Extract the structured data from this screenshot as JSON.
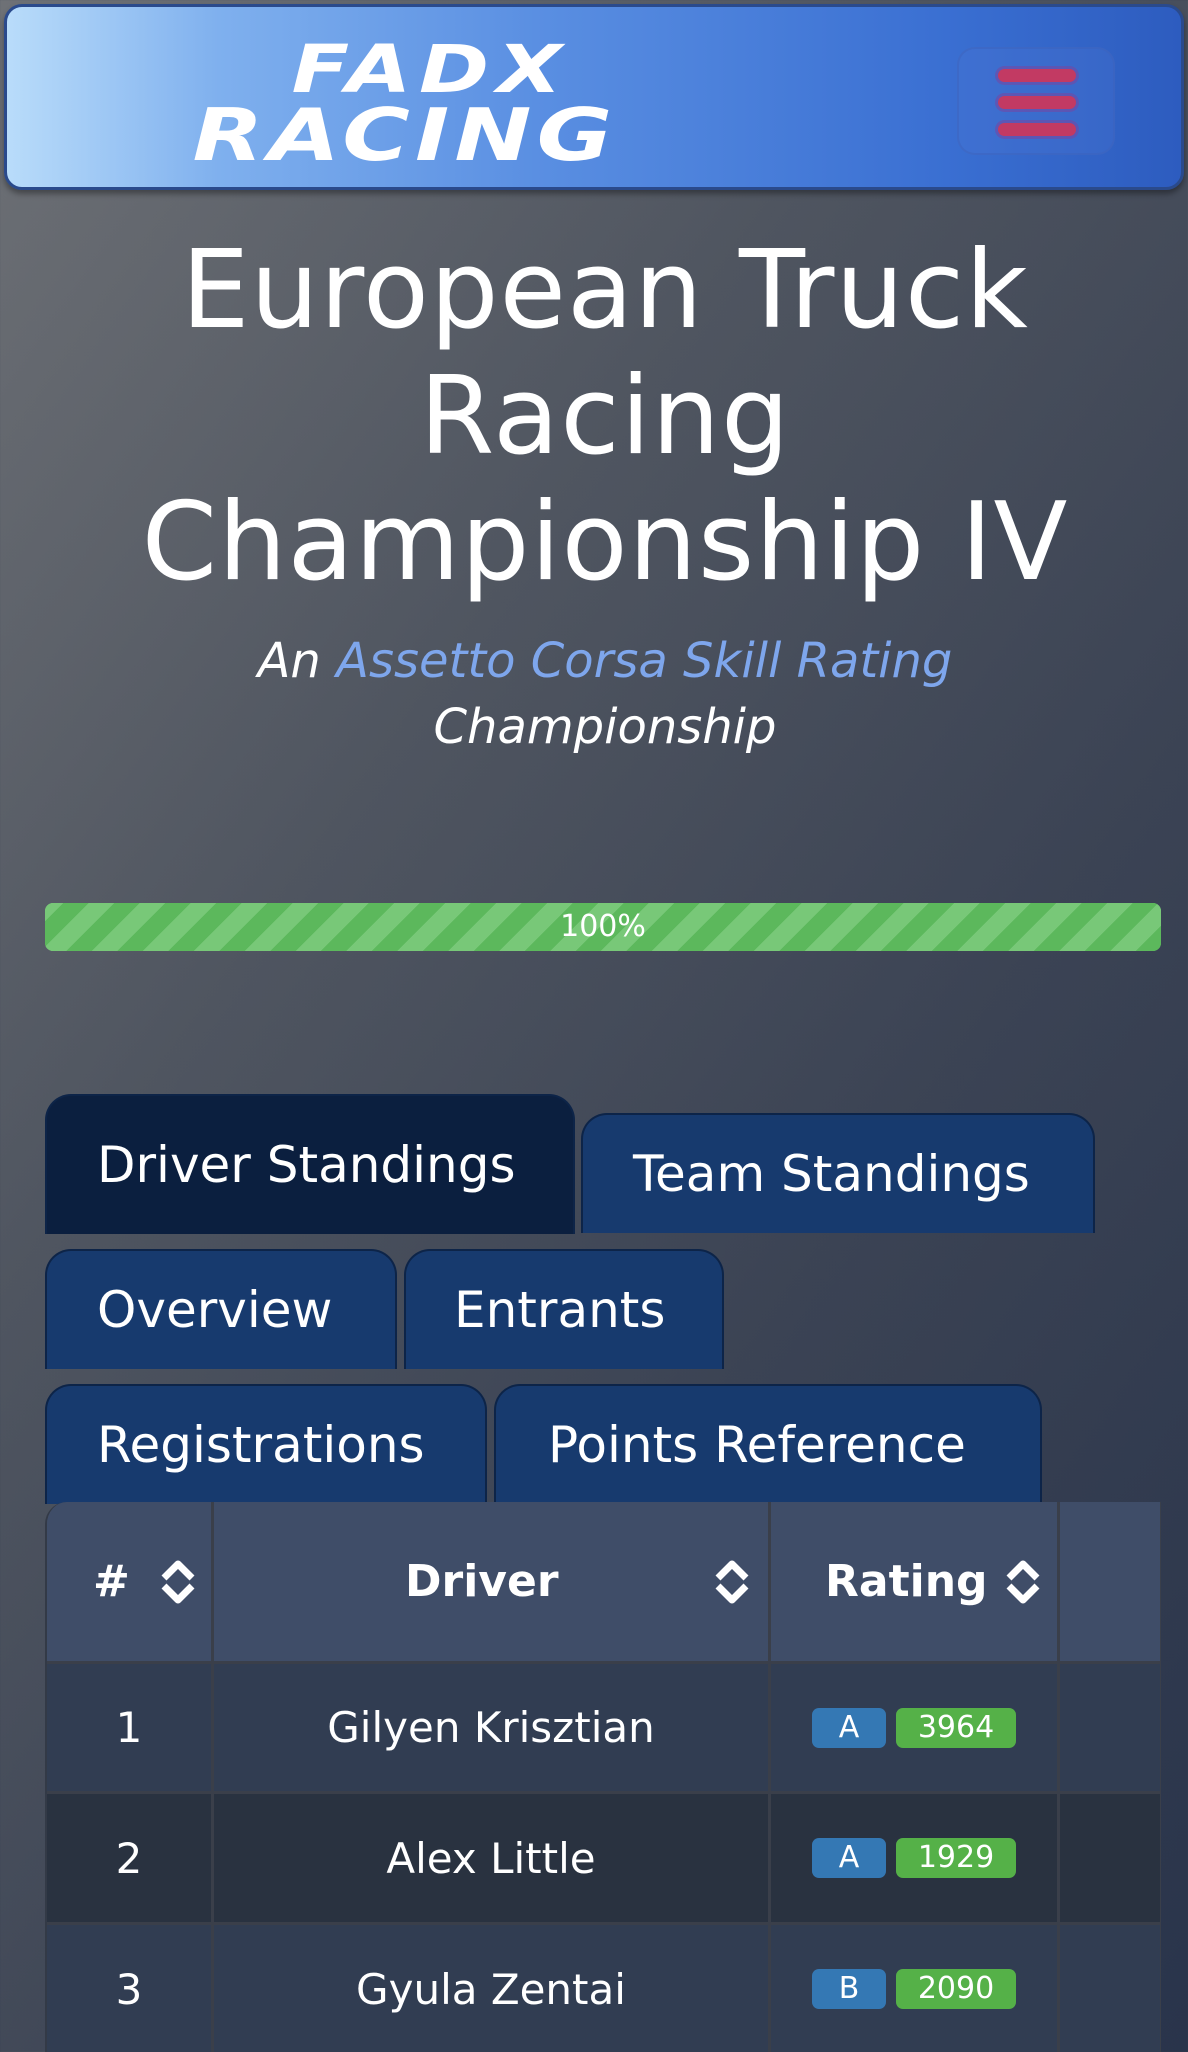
{
  "navbar": {
    "logo_line1": "FADX",
    "logo_line2": "RACING",
    "menu_icon": "hamburger-icon",
    "menu_color": "#c23a63"
  },
  "hero": {
    "title": "European Truck Racing Championship IV",
    "subtitle_prefix": "An",
    "subtitle_link": "Assetto Corsa Skill Rating",
    "subtitle_suffix": "Championship",
    "accent_color": "#7ea6ec"
  },
  "progress": {
    "value": 1.0,
    "label": "100%",
    "color": "#5cb85c"
  },
  "tabs": [
    {
      "label": "Driver Standings",
      "active": true
    },
    {
      "label": "Team Standings",
      "active": false
    },
    {
      "label": "Overview",
      "active": false
    },
    {
      "label": "Entrants",
      "active": false
    },
    {
      "label": "Registrations",
      "active": false
    },
    {
      "label": "Points Reference",
      "active": false
    }
  ],
  "table": {
    "headers": {
      "pos": "#",
      "driver": "Driver",
      "rating": "Rating"
    },
    "sort_icon": "sort-updown-icon",
    "rows": [
      {
        "pos": "1",
        "driver": "Gilyen Krisztian",
        "class": "A",
        "sr": "3964"
      },
      {
        "pos": "2",
        "driver": "Alex Little",
        "class": "A",
        "sr": "1929"
      },
      {
        "pos": "3",
        "driver": "Gyula Zentai",
        "class": "B",
        "sr": "2090"
      }
    ]
  }
}
